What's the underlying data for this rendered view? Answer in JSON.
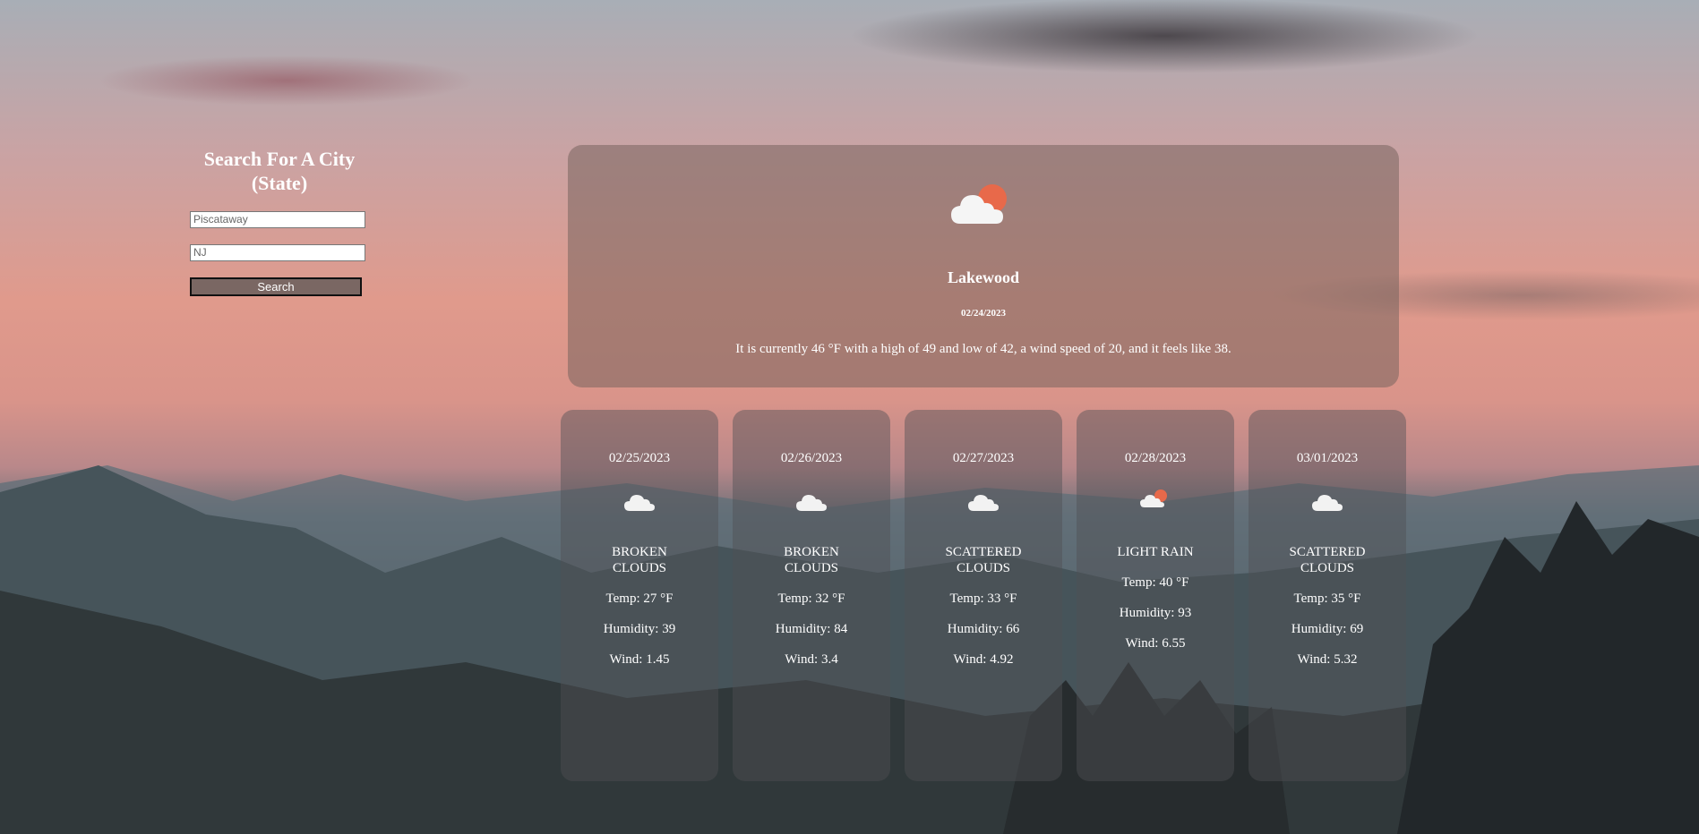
{
  "search": {
    "title_line1": "Search For A City",
    "title_line2": "(State)",
    "city_value": "Piscataway",
    "state_value": "NJ",
    "button_label": "Search"
  },
  "current": {
    "city": "Lakewood",
    "date": "02/24/2023",
    "summary": "It is currently 46 °F with a high of 49 and low of 42, a wind speed of 20, and it feels like 38.",
    "icon": "cloud-sun-icon"
  },
  "forecast": [
    {
      "date": "02/25/2023",
      "icon": "cloud-icon",
      "desc_line1": "BROKEN",
      "desc_line2": "CLOUDS",
      "temp": "Temp: 27 °F",
      "humidity": "Humidity: 39",
      "wind": "Wind: 1.45"
    },
    {
      "date": "02/26/2023",
      "icon": "cloud-icon",
      "desc_line1": "BROKEN",
      "desc_line2": "CLOUDS",
      "temp": "Temp: 32 °F",
      "humidity": "Humidity: 84",
      "wind": "Wind: 3.4"
    },
    {
      "date": "02/27/2023",
      "icon": "cloud-icon",
      "desc_line1": "SCATTERED",
      "desc_line2": "CLOUDS",
      "temp": "Temp: 33 °F",
      "humidity": "Humidity: 66",
      "wind": "Wind: 4.92"
    },
    {
      "date": "02/28/2023",
      "icon": "cloud-sun-icon",
      "desc_line1": "LIGHT RAIN",
      "desc_line2": "",
      "temp": "Temp: 40 °F",
      "humidity": "Humidity: 93",
      "wind": "Wind: 6.55"
    },
    {
      "date": "03/01/2023",
      "icon": "cloud-icon",
      "desc_line1": "SCATTERED",
      "desc_line2": "CLOUDS",
      "temp": "Temp: 35 °F",
      "humidity": "Humidity: 69",
      "wind": "Wind: 5.32"
    }
  ],
  "colors": {
    "sun": "#e8694a",
    "button_bg": "#7a6763"
  }
}
